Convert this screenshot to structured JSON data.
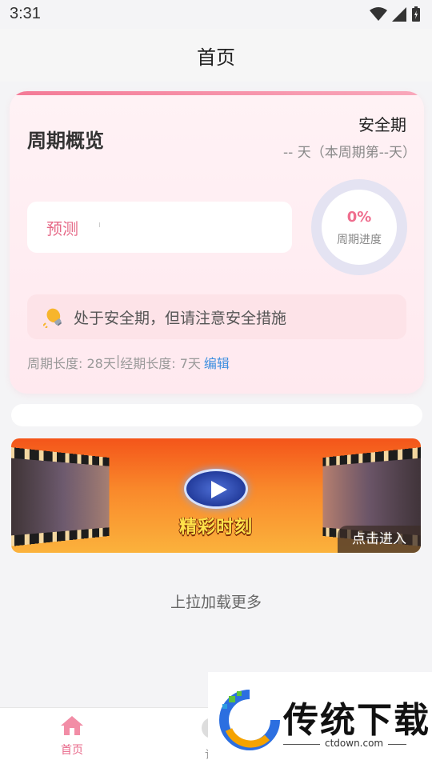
{
  "status_bar": {
    "time": "3:31"
  },
  "header": {
    "title": "首页"
  },
  "cycle_card": {
    "title": "周期概览",
    "phase": "安全期",
    "day_text": "-- 天（本周期第--天）",
    "predict_label": "预测",
    "progress_value": "0%",
    "progress_fraction": 0,
    "progress_label": "周期进度",
    "tip": "处于安全期，但请注意安全措施",
    "cycle_length": "周期长度: 28天",
    "separator": "|",
    "period_length": "经期长度: 7天",
    "edit_label": "编辑"
  },
  "banner": {
    "title": "精彩时刻",
    "enter_label": "点击进入"
  },
  "feed": {
    "load_more": "上拉加载更多"
  },
  "tab_bar": {
    "home_label": "首页",
    "second_label": "记"
  },
  "watermark": {
    "text": "传统下载",
    "url": "ctdown.com"
  },
  "colors": {
    "accent": "#ef6e8e",
    "link": "#3d8fe0",
    "banner_orange": "#f4551a"
  },
  "icons": {
    "tip": "lightbulb-icon",
    "home": "home-icon",
    "play": "play-icon"
  }
}
